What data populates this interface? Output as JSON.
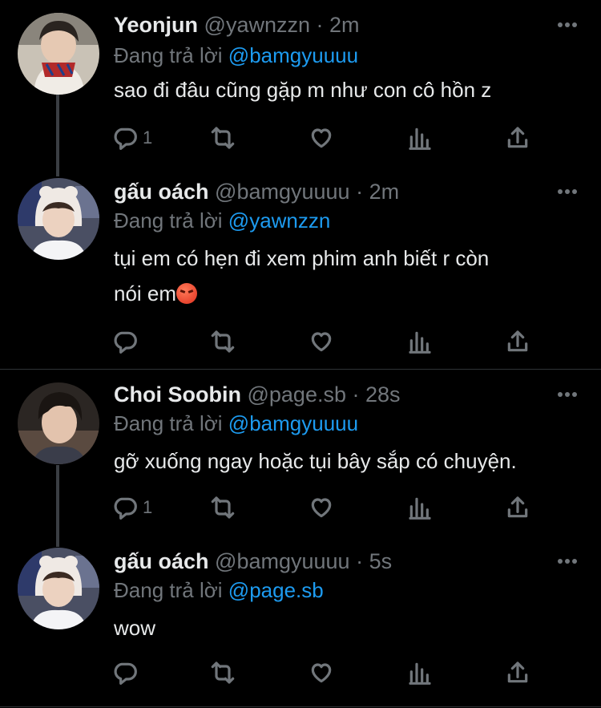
{
  "tweets": [
    {
      "name": "Yeonjun",
      "handle": "@yawnzzn",
      "sep": "·",
      "time": "2m",
      "replying_prefix": "Đang trả lời",
      "replying_to": "@bamgyuuuu",
      "text": "sao đi đâu cũng gặp m như con cô hồn z",
      "reply_count": "1",
      "avatar_icon": "person-avatar-scarf"
    },
    {
      "name": "gấu oách",
      "handle": "@bamgyuuuu",
      "sep": "·",
      "time": "2m",
      "replying_prefix": "Đang trả lời",
      "replying_to": "@yawnzzn",
      "text": "tụi em có hẹn đi xem phim anh biết r còn",
      "text2": "nói em",
      "emoji": "angry-face-emoji",
      "reply_count": "",
      "avatar_icon": "person-avatar-hood"
    },
    {
      "name": "Choi Soobin",
      "handle": "@page.sb",
      "sep": "·",
      "time": "28s",
      "replying_prefix": "Đang trả lời",
      "replying_to": "@bamgyuuuu",
      "text": "gỡ xuống ngay hoặc tụi bây sắp có chuyện.",
      "reply_count": "1",
      "avatar_icon": "person-avatar-dark-hair"
    },
    {
      "name": "gấu oách",
      "handle": "@bamgyuuuu",
      "sep": "·",
      "time": "5s",
      "replying_prefix": "Đang trả lời",
      "replying_to": "@page.sb",
      "text": "wow",
      "reply_count": "",
      "avatar_icon": "person-avatar-hood"
    }
  ],
  "colors": {
    "background": "#000000",
    "text": "#e7e9ea",
    "muted": "#71767b",
    "link": "#1d9bf0"
  }
}
